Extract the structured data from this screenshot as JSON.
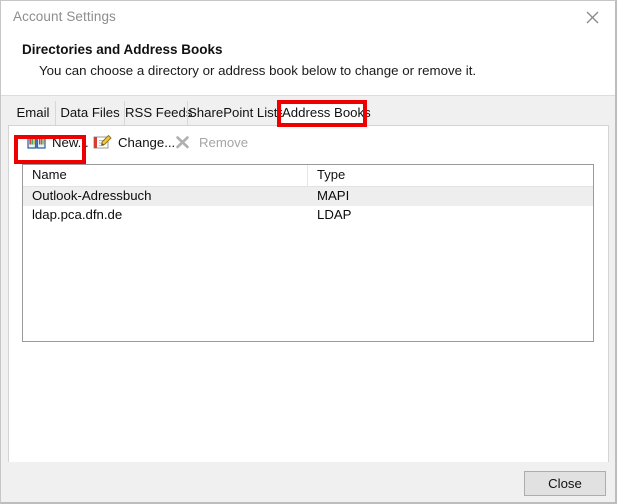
{
  "window": {
    "title": "Account Settings",
    "close_icon": "close-icon"
  },
  "header": {
    "title": "Directories and Address Books",
    "description": "You can choose a directory or address book below to change or remove it."
  },
  "tabs": [
    {
      "label": "Email",
      "selected": false
    },
    {
      "label": "Data Files",
      "selected": false
    },
    {
      "label": "RSS Feeds",
      "selected": false
    },
    {
      "label": "SharePoint Lists",
      "selected": false
    },
    {
      "label": "Address Books",
      "selected": true
    }
  ],
  "toolbar": {
    "new_label": "New...",
    "new_icon": "open-book-icon",
    "change_label": "Change...",
    "change_icon": "edit-card-icon",
    "remove_label": "Remove",
    "remove_icon": "x-cross-icon",
    "remove_disabled": true
  },
  "list": {
    "columns": [
      "Name",
      "Type"
    ],
    "rows": [
      {
        "name": "Outlook-Adressbuch",
        "type": "MAPI",
        "selected": true
      },
      {
        "name": "ldap.pca.dfn.de",
        "type": "LDAP",
        "selected": false
      }
    ]
  },
  "footer": {
    "close_label": "Close"
  },
  "annotations": {
    "highlight_color": "#ee0000",
    "boxes": [
      "Address Books",
      "New..."
    ]
  }
}
